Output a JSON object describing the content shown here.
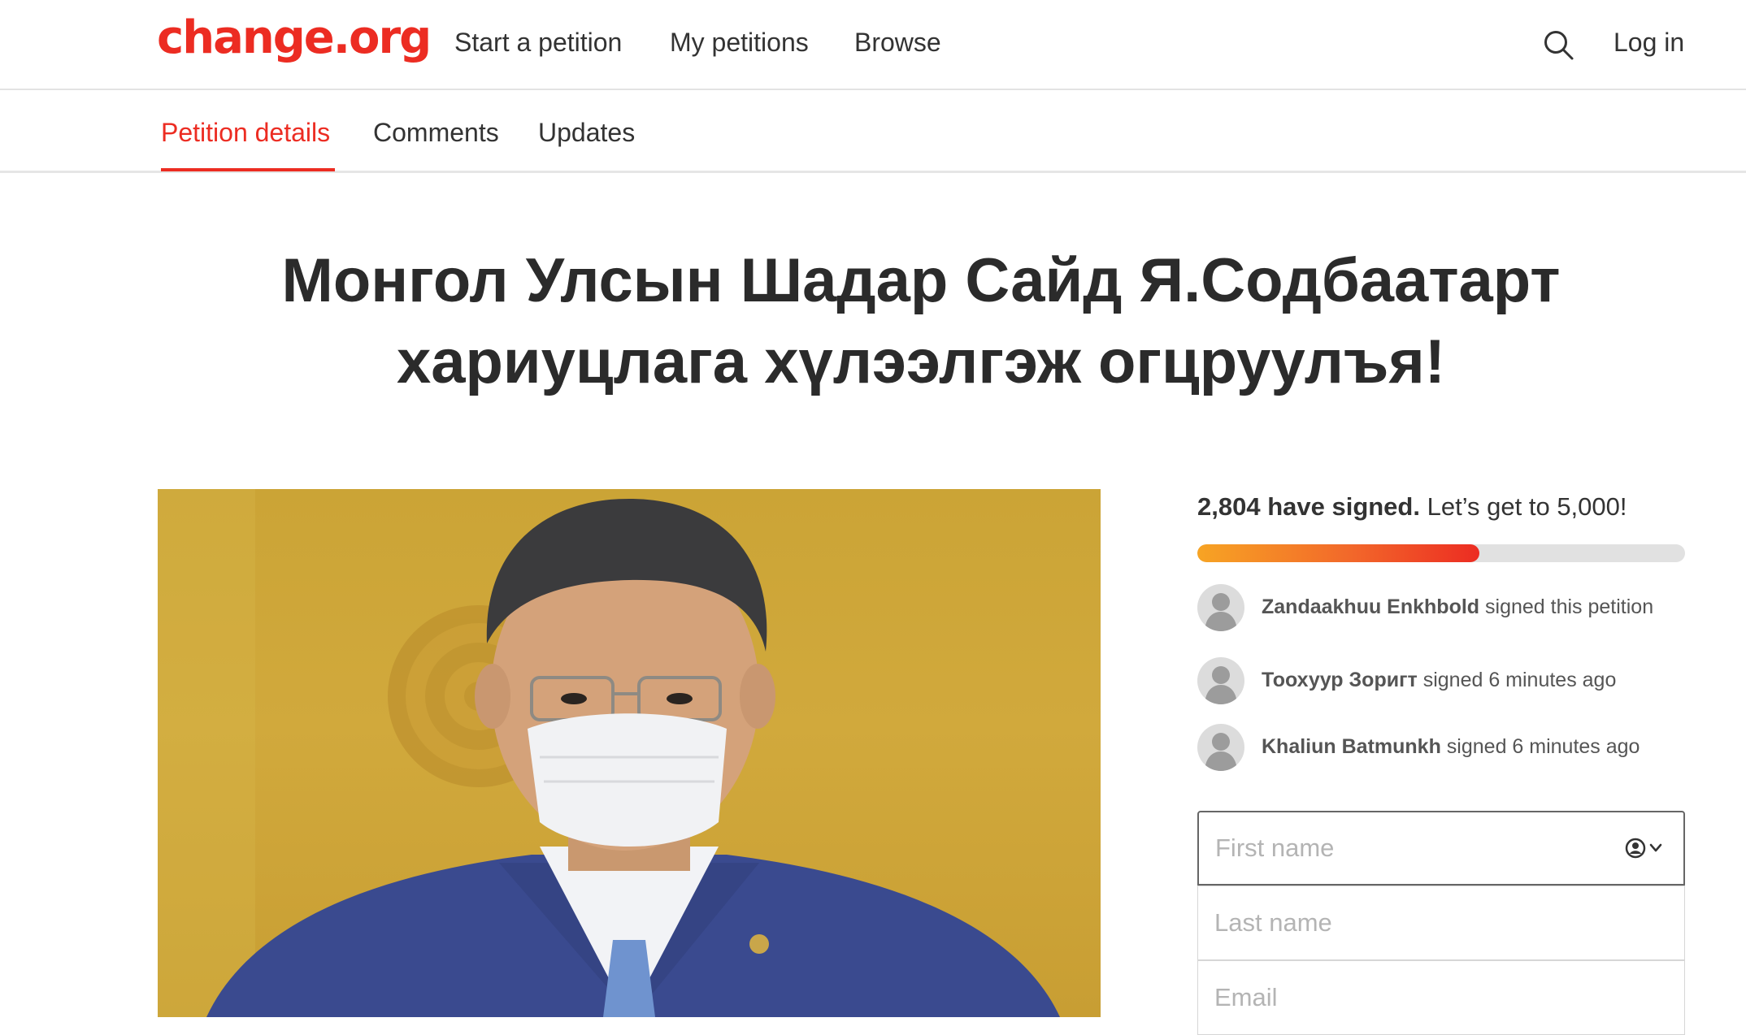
{
  "header": {
    "logo": "change.org",
    "nav": [
      {
        "label": "Start a petition"
      },
      {
        "label": "My petitions"
      },
      {
        "label": "Browse"
      }
    ],
    "search_icon": "search-icon",
    "login_label": "Log in"
  },
  "tabs": [
    {
      "label": "Petition details",
      "active": true
    },
    {
      "label": "Comments",
      "active": false
    },
    {
      "label": "Updates",
      "active": false
    }
  ],
  "petition": {
    "title_line1": "Монгол Улсын Шадар Сайд Я.Содбаатарт",
    "title_line2": "хариуцлага хүлээлгэж огцруулъя!"
  },
  "signatures": {
    "count_text": "2,804 have signed.",
    "goal_text": "Let’s get to 5,000!",
    "count": 2804,
    "goal": 5000,
    "progress_fraction": 0.578
  },
  "recent_signers": [
    {
      "name": "Zandaakhuu Enkhbold",
      "action": "signed this petition"
    },
    {
      "name": "Тоохуур Зоригт",
      "action": "signed 6 minutes ago"
    },
    {
      "name": "Khaliun Batmunkh",
      "action": "signed 6 minutes ago"
    }
  ],
  "form": {
    "first_name_placeholder": "First name",
    "last_name_placeholder": "Last name",
    "email_placeholder": "Email",
    "autofill_icon": "contact-autofill-icon"
  },
  "colors": {
    "brand_red": "#ec2c22",
    "progress_start": "#f7a424",
    "progress_end": "#ec2c22"
  }
}
